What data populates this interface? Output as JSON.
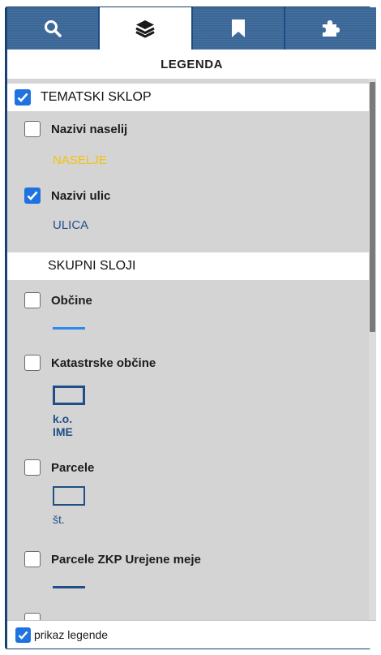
{
  "tabs": [
    {
      "icon": "search-icon"
    },
    {
      "icon": "layers-icon",
      "active": true
    },
    {
      "icon": "bookmark-icon"
    },
    {
      "icon": "puzzle-icon"
    }
  ],
  "legend": {
    "title": "LEGENDA"
  },
  "groups": {
    "tematski": {
      "label": "TEMATSKI SKLOP",
      "checked": true
    },
    "skupni": {
      "label": "SKUPNI SLOJI"
    }
  },
  "layers": {
    "nazivi_naselij": {
      "label": "Nazivi naselij",
      "symbol_text": "NASELJE",
      "symbol_color": "#f4c20d"
    },
    "nazivi_ulic": {
      "label": "Nazivi ulic",
      "symbol_text": "ULICA",
      "symbol_color": "#1f4f86"
    },
    "obcine": {
      "label": "Občine",
      "line_color": "#2b8af0"
    },
    "katastrske": {
      "label": "Katastrske občine",
      "ko_label": "k.o.",
      "ime_label": "IME",
      "color": "#1f4f86"
    },
    "parcele": {
      "label": "Parcele",
      "st_label": "št.",
      "color": "#1f4f86"
    },
    "parcele_zkp": {
      "label": "Parcele ZKP Urejene meje",
      "line_color": "#1f4f86"
    }
  },
  "footer": {
    "label": "prikaz legende",
    "checked": true
  },
  "colors": {
    "accent": "#1e73e0",
    "frame": "#1c4d82",
    "tab_inactive": "#3b6797",
    "panel_bg": "#d4d4d4"
  }
}
